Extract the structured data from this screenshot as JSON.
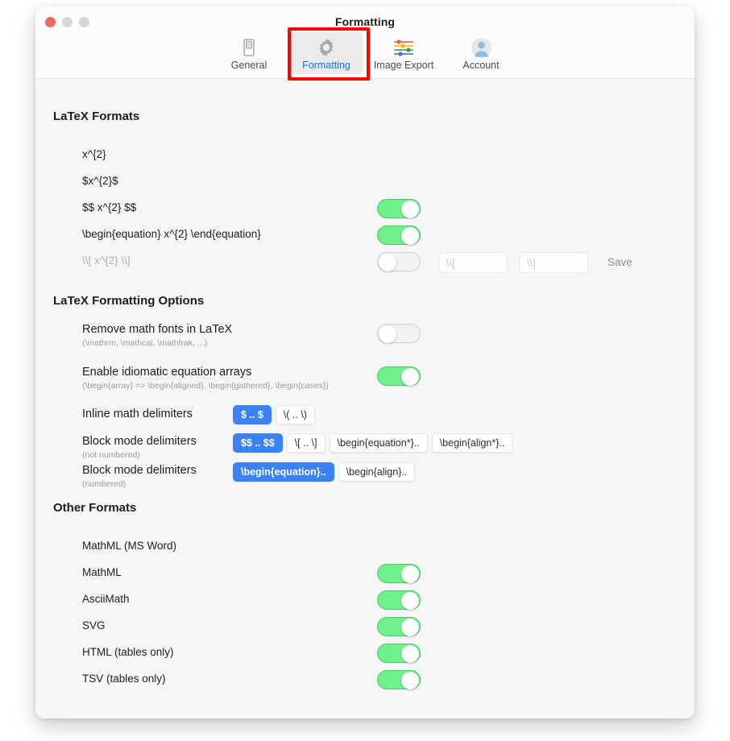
{
  "window": {
    "title": "Formatting",
    "traffic_lights": [
      "close",
      "minimize",
      "zoom"
    ]
  },
  "toolbar": {
    "tabs": [
      {
        "label": "General",
        "icon": "switch-icon",
        "selected": false
      },
      {
        "label": "Formatting",
        "icon": "gear-icon",
        "selected": true
      },
      {
        "label": "Image Export",
        "icon": "sliders-icon",
        "selected": false
      },
      {
        "label": "Account",
        "icon": "person-icon",
        "selected": false
      }
    ]
  },
  "annotation": {
    "target": "Formatting",
    "color": "#ff0000"
  },
  "sections": {
    "latex_formats": {
      "title": "LaTeX Formats",
      "rows": [
        {
          "label": "x^{2}",
          "toggle": null,
          "disabled": false
        },
        {
          "label": "$x^{2}$",
          "toggle": null,
          "disabled": false
        },
        {
          "label": "$$ x^{2} $$",
          "toggle": "on",
          "disabled": false
        },
        {
          "label": "\\begin{equation} x^{2} \\end{equation}",
          "toggle": "on",
          "disabled": false
        },
        {
          "label": "\\\\[ x^{2} \\\\]",
          "toggle": "off",
          "disabled": true
        }
      ],
      "open_delim_placeholder": "\\\\[",
      "close_delim_placeholder": "\\\\]",
      "open_delim_value": "",
      "close_delim_value": "",
      "save_label": "Save"
    },
    "latex_options": {
      "title": "LaTeX Formatting Options",
      "rows": [
        {
          "label": "Remove math fonts in LaTeX",
          "sub": "(\\mathrm, \\mathcal, \\mathfrak, ...)",
          "toggle": "off"
        },
        {
          "label": "Enable idiomatic equation arrays",
          "sub": "(\\begin{array} => \\begin{aligned}, \\begin{gathered}, \\begin{cases})",
          "toggle": "on"
        }
      ],
      "delimiter_rows": [
        {
          "label": "Inline math delimiters",
          "sub": "",
          "options": [
            {
              "label": "$ .. $",
              "active": true
            },
            {
              "label": "\\( .. \\)",
              "active": false
            }
          ]
        },
        {
          "label": "Block mode delimiters",
          "sub": "(not numbered)",
          "options": [
            {
              "label": "$$ .. $$",
              "active": true
            },
            {
              "label": "\\[ .. \\]",
              "active": false
            },
            {
              "label": "\\begin{equation*}..",
              "active": false
            },
            {
              "label": "\\begin{align*}..",
              "active": false
            }
          ]
        },
        {
          "label": "Block mode delimiters",
          "sub": "(numbered)",
          "options": [
            {
              "label": "\\begin{equation}..",
              "active": true
            },
            {
              "label": "\\begin{align}..",
              "active": false
            }
          ]
        }
      ]
    },
    "other_formats": {
      "title": "Other Formats",
      "rows": [
        {
          "label": "MathML (MS Word)",
          "toggle": null
        },
        {
          "label": "MathML",
          "toggle": "on"
        },
        {
          "label": "AsciiMath",
          "toggle": "on"
        },
        {
          "label": "SVG",
          "toggle": "on"
        },
        {
          "label": "HTML (tables only)",
          "toggle": "on"
        },
        {
          "label": "TSV (tables only)",
          "toggle": "on"
        }
      ]
    }
  }
}
